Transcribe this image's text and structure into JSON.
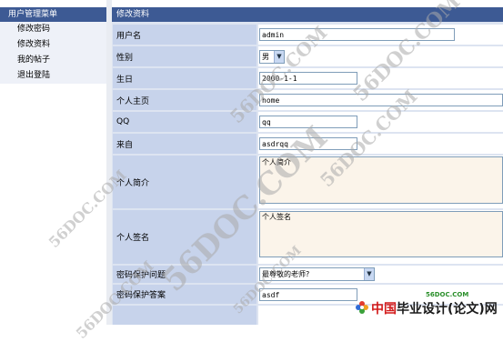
{
  "menu": {
    "title": "用户管理菜单",
    "items": [
      "修改密码",
      "修改资料",
      "我的帖子",
      "退出登陆"
    ]
  },
  "form": {
    "title": "修改资料",
    "fields": {
      "username": {
        "label": "用户名",
        "value": "admin"
      },
      "gender": {
        "label": "性别",
        "value": "男"
      },
      "birthday": {
        "label": "生日",
        "value": "2000-1-1"
      },
      "homepage": {
        "label": "个人主页",
        "value": "home"
      },
      "qq": {
        "label": "QQ",
        "value": "qq"
      },
      "from": {
        "label": "来自",
        "value": "asdrqq"
      },
      "intro": {
        "label": "个人简介",
        "value": "个人简介"
      },
      "signature": {
        "label": "个人签名",
        "value": "个人签名"
      },
      "question": {
        "label": "密码保护问题",
        "value": "最尊敬的老师?"
      },
      "answer": {
        "label": "密码保护答案",
        "value": "asdf"
      }
    }
  },
  "watermark": {
    "text": "56DOC.COM",
    "logo_small": "56DOC.COM",
    "logo_cn": "中国",
    "logo_main": "毕业设计(论文)网"
  },
  "colors": {
    "header": "#3d5a94",
    "label_bg": "#c7d3eb",
    "menu_bg": "#eef1f8"
  }
}
